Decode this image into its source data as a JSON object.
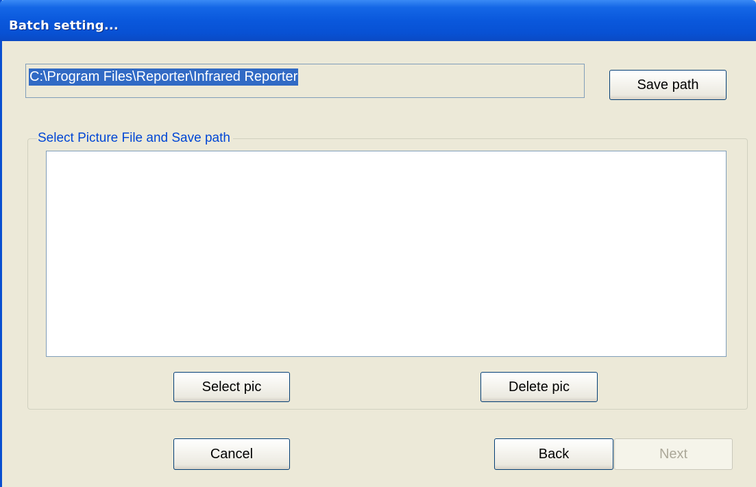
{
  "window": {
    "title": "Batch setting..."
  },
  "save_path": {
    "path_value": "C:\\Program Files\\Reporter\\Infrared Reporter",
    "button_label": "Save path"
  },
  "picture_group": {
    "legend": "Select Picture File and Save path",
    "items": [],
    "select_label": "Select pic",
    "delete_label": "Delete pic"
  },
  "footer": {
    "cancel_label": "Cancel",
    "back_label": "Back",
    "next_label": "Next",
    "next_enabled": false
  },
  "colors": {
    "title_bar": "#0a58dc",
    "dialog_background": "#ece9d8",
    "group_legend": "#0046d5",
    "selection_highlight": "#316ac5"
  }
}
